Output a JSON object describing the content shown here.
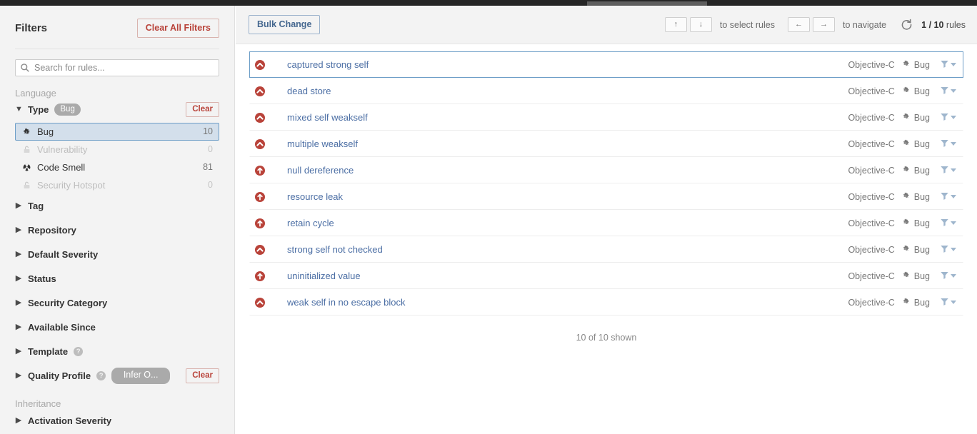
{
  "sidebar": {
    "title": "Filters",
    "clear_all_label": "Clear All Filters",
    "search": {
      "placeholder": "Search for rules...",
      "value": "",
      "icon": "search-icon"
    },
    "language_label": "Language",
    "inheritance_label": "Inheritance",
    "type_facet": {
      "name": "Type",
      "badge": "Bug",
      "clear_label": "Clear",
      "chevron": "expanded",
      "items": [
        {
          "label": "Bug",
          "count": "10",
          "icon": "bug-icon",
          "selected": true,
          "disabled": false
        },
        {
          "label": "Vulnerability",
          "count": "0",
          "icon": "unlock-icon",
          "selected": false,
          "disabled": true
        },
        {
          "label": "Code Smell",
          "count": "81",
          "icon": "code-smell-icon",
          "selected": false,
          "disabled": false
        },
        {
          "label": "Security Hotspot",
          "count": "0",
          "icon": "unlock-icon",
          "selected": false,
          "disabled": true
        }
      ]
    },
    "facets": [
      {
        "name": "Tag",
        "help": false,
        "badge": null,
        "clear": null
      },
      {
        "name": "Repository",
        "help": false,
        "badge": null,
        "clear": null
      },
      {
        "name": "Default Severity",
        "help": false,
        "badge": null,
        "clear": null
      },
      {
        "name": "Status",
        "help": false,
        "badge": null,
        "clear": null
      },
      {
        "name": "Security Category",
        "help": false,
        "badge": null,
        "clear": null
      },
      {
        "name": "Available Since",
        "help": false,
        "badge": null,
        "clear": null
      },
      {
        "name": "Template",
        "help": true,
        "badge": null,
        "clear": null
      },
      {
        "name": "Quality Profile",
        "help": true,
        "badge": "Infer O...",
        "clear": "Clear"
      }
    ],
    "inheritance_facets": [
      {
        "name": "Activation Severity",
        "help": false,
        "badge": null,
        "clear": null
      }
    ]
  },
  "toolbar": {
    "bulk_change_label": "Bulk Change",
    "select_keys": [
      "↑",
      "↓"
    ],
    "select_hint": "to select rules",
    "navigate_keys": [
      "←",
      "→"
    ],
    "navigate_hint": "to navigate",
    "reload_icon": "reload-icon",
    "rules_position": "1 / 10",
    "rules_suffix": "rules"
  },
  "rules": {
    "lang_label": "Objective-C",
    "type_label": "Bug",
    "filter_icon": "funnel-icon",
    "shown_text": "10 of 10 shown",
    "items": [
      {
        "name": "captured strong self",
        "severity": "major",
        "language": "Objective-C",
        "type": "Bug",
        "selected": true
      },
      {
        "name": "dead store",
        "severity": "major",
        "language": "Objective-C",
        "type": "Bug",
        "selected": false
      },
      {
        "name": "mixed self weakself",
        "severity": "major",
        "language": "Objective-C",
        "type": "Bug",
        "selected": false
      },
      {
        "name": "multiple weakself",
        "severity": "major",
        "language": "Objective-C",
        "type": "Bug",
        "selected": false
      },
      {
        "name": "null dereference",
        "severity": "critical",
        "language": "Objective-C",
        "type": "Bug",
        "selected": false
      },
      {
        "name": "resource leak",
        "severity": "critical",
        "language": "Objective-C",
        "type": "Bug",
        "selected": false
      },
      {
        "name": "retain cycle",
        "severity": "critical",
        "language": "Objective-C",
        "type": "Bug",
        "selected": false
      },
      {
        "name": "strong self not checked",
        "severity": "major",
        "language": "Objective-C",
        "type": "Bug",
        "selected": false
      },
      {
        "name": "uninitialized value",
        "severity": "critical",
        "language": "Objective-C",
        "type": "Bug",
        "selected": false
      },
      {
        "name": "weak self in no escape block",
        "severity": "major",
        "language": "Objective-C",
        "type": "Bug",
        "selected": false
      }
    ]
  },
  "colors": {
    "severity_red": "#b9433a",
    "link_blue": "#4b6ea4",
    "selection_blue": "#6d9ec7",
    "selection_fill": "#d3dfeb",
    "sidebar_bg": "#f3f3f3"
  }
}
